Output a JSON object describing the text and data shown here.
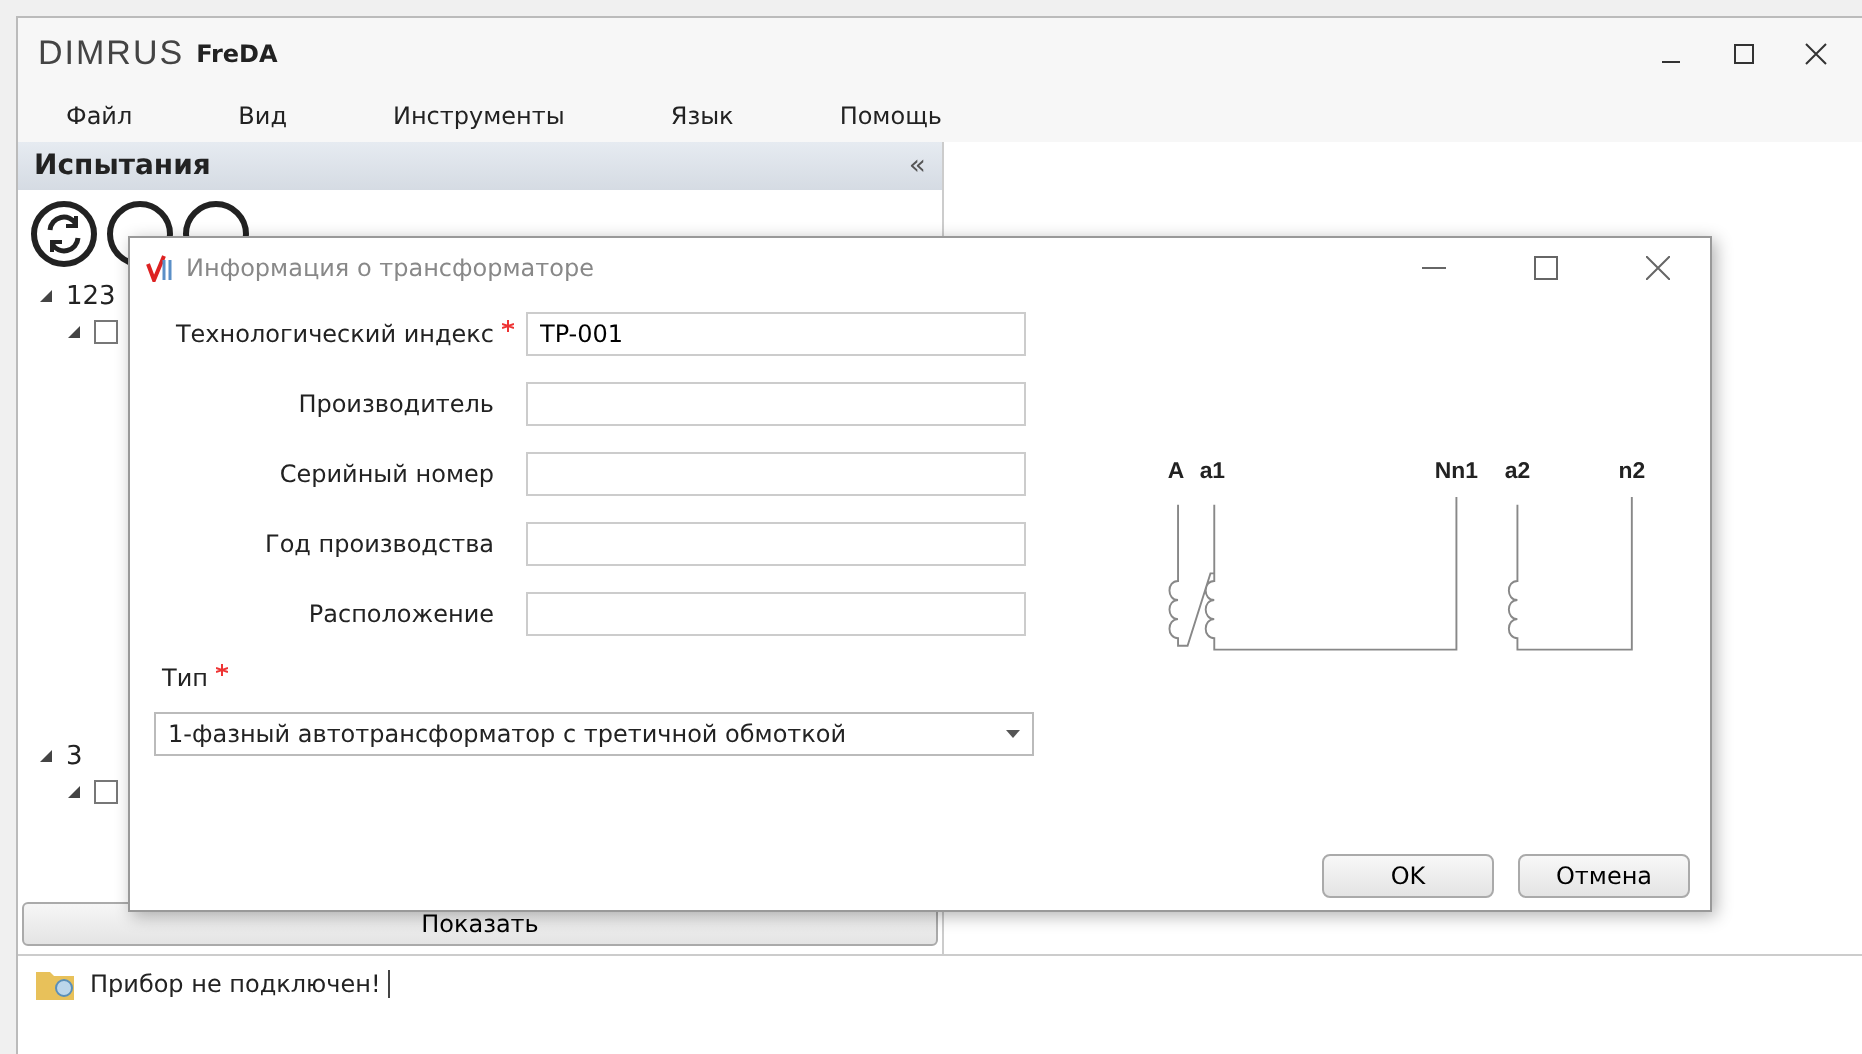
{
  "app": {
    "logo": "DIMRUS",
    "title": "FreDA"
  },
  "menu": [
    {
      "label": "Файл"
    },
    {
      "label": "Вид"
    },
    {
      "label": "Инструменты"
    },
    {
      "label": "Язык"
    },
    {
      "label": "Помощь"
    }
  ],
  "panel": {
    "title": "Испытания",
    "collapse": "«",
    "tree": [
      {
        "label": "123",
        "expanded": true,
        "children": [
          {
            "checked": false
          }
        ]
      },
      {
        "label": "3",
        "expanded": true,
        "children": [
          {
            "checked": false
          }
        ]
      }
    ],
    "show_button": "Показать"
  },
  "status_bar": {
    "message": "Прибор не подключен!"
  },
  "dialog": {
    "title": "Информация о трансформаторе",
    "fields": [
      {
        "label": "Технологический индекс",
        "required": true,
        "value": "TP-001"
      },
      {
        "label": "Производитель",
        "required": false
      },
      {
        "label": "Серийный номер",
        "required": false
      },
      {
        "label": "Год производства",
        "required": false
      },
      {
        "label": "Расположение",
        "required": false
      }
    ],
    "type": {
      "label": "Тип",
      "required": true,
      "value": "1-фазный автотрансформатор с третичной обмоткой"
    },
    "terminals": [
      "A",
      "a1",
      "Nn1",
      "a2",
      "n2"
    ],
    "buttons": [
      {
        "label": "OK"
      },
      {
        "label": "Отмена"
      }
    ]
  }
}
